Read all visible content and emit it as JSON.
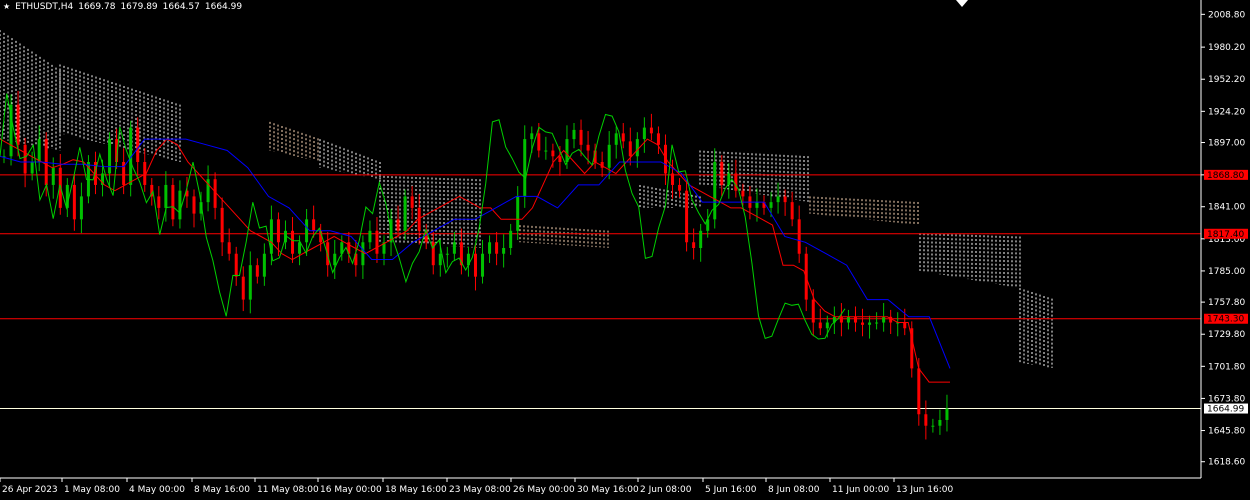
{
  "header": {
    "symbol": "ETHUSDT,H4",
    "open": "1669.78",
    "high": "1679.89",
    "low": "1664.57",
    "close": "1664.99"
  },
  "colors": {
    "background": "#000000",
    "bull_candle": "#00c000",
    "bear_candle": "#ff0000",
    "tenkan": "#ff0000",
    "kijun": "#0000ff",
    "chikou": "#00d000",
    "kumo_a": "#ffdab9",
    "kumo_b": "#ffffff",
    "level_line": "#ff0000",
    "current_price_line": "#ffffe0",
    "axis_text": "#ffffff"
  },
  "chart_data": {
    "type": "candlestick",
    "indicator": "ichimoku",
    "ylim": [
      1604.4,
      2021.3
    ],
    "price_ticks": [
      "2008.80",
      "1980.20",
      "1952.20",
      "1924.20",
      "1897.00",
      "1868.80",
      "1841.00",
      "1813.00",
      "1785.00",
      "1757.80",
      "1729.80",
      "1701.80",
      "1673.80",
      "1645.80",
      "1618.60"
    ],
    "time_ticks": [
      "26 Apr 2023",
      "1 May 08:00",
      "4 May 00:00",
      "8 May 16:00",
      "11 May 08:00",
      "16 May 00:00",
      "18 May 16:00",
      "23 May 08:00",
      "26 May 00:00",
      "30 May 16:00",
      "2 Jun 08:00",
      "5 Jun 16:00",
      "8 Jun 08:00",
      "11 Jun 00:00",
      "13 Jun 16:00"
    ],
    "level_lines": [
      {
        "price": 1868.8,
        "label": "1868.80"
      },
      {
        "price": 1817.4,
        "label": "1817.40"
      },
      {
        "price": 1743.3,
        "label": "1743.30"
      }
    ],
    "current_price": {
      "price": 1664.99,
      "label": "1664.99"
    },
    "close_path": [
      1885,
      1930,
      1895,
      1870,
      1880,
      1900,
      1860,
      1875,
      1840,
      1860,
      1830,
      1850,
      1880,
      1860,
      1870,
      1900,
      1880,
      1860,
      1910,
      1880,
      1860,
      1850,
      1840,
      1860,
      1830,
      1855,
      1850,
      1835,
      1845,
      1865,
      1840,
      1810,
      1800,
      1780,
      1760,
      1790,
      1780,
      1800,
      1830,
      1810,
      1820,
      1800,
      1810,
      1830,
      1820,
      1810,
      1790,
      1800,
      1810,
      1800,
      1790,
      1810,
      1820,
      1800,
      1810,
      1830,
      1820,
      1850,
      1840,
      1820,
      1810,
      1790,
      1800,
      1800,
      1810,
      1790,
      1800,
      1780,
      1800,
      1810,
      1800,
      1805,
      1820,
      1850,
      1900,
      1905,
      1890,
      1890,
      1885,
      1880,
      1900,
      1908,
      1895,
      1890,
      1880,
      1875,
      1895,
      1905,
      1898,
      1885,
      1900,
      1910,
      1905,
      1895,
      1870,
      1860,
      1855,
      1810,
      1805,
      1820,
      1830,
      1880,
      1860,
      1870,
      1855,
      1850,
      1840,
      1845,
      1840,
      1845,
      1850,
      1845,
      1830,
      1800,
      1760,
      1740,
      1735,
      1740,
      1745,
      1740,
      1745,
      1740,
      1738,
      1740,
      1740,
      1745,
      1740,
      1740,
      1735,
      1700,
      1660,
      1650,
      1650,
      1655,
      1665
    ],
    "tenkan_path": [
      1900,
      1895,
      1890,
      1885,
      1880,
      1875,
      1878,
      1882,
      1880,
      1870,
      1860,
      1855,
      1860,
      1865,
      1870,
      1890,
      1900,
      1895,
      1880,
      1870,
      1860,
      1850,
      1840,
      1830,
      1820,
      1815,
      1810,
      1800,
      1795,
      1800,
      1805,
      1810,
      1815,
      1810,
      1805,
      1800,
      1805,
      1810,
      1815,
      1820,
      1830,
      1835,
      1840,
      1845,
      1850,
      1845,
      1840,
      1840,
      1830,
      1830,
      1830,
      1840,
      1860,
      1880,
      1890,
      1880,
      1870,
      1880,
      1875,
      1870,
      1880,
      1890,
      1900,
      1895,
      1880,
      1870,
      1860,
      1855,
      1850,
      1845,
      1840,
      1840,
      1835,
      1830,
      1825,
      1790,
      1790,
      1785,
      1760,
      1750,
      1745,
      1745,
      1745,
      1745,
      1745,
      1745,
      1740,
      1740,
      1700,
      1688,
      1688,
      1688
    ],
    "kijun_path": [
      1885,
      1880,
      1880,
      1878,
      1878,
      1876,
      1876,
      1900,
      1900,
      1900,
      1895,
      1890,
      1875,
      1850,
      1840,
      1820,
      1820,
      1815,
      1795,
      1795,
      1810,
      1820,
      1830,
      1830,
      1840,
      1850,
      1850,
      1840,
      1860,
      1860,
      1880,
      1880,
      1880,
      1870,
      1845,
      1845,
      1845,
      1845,
      1815,
      1810,
      1800,
      1790,
      1760,
      1760,
      1745,
      1745,
      1700
    ]
  }
}
